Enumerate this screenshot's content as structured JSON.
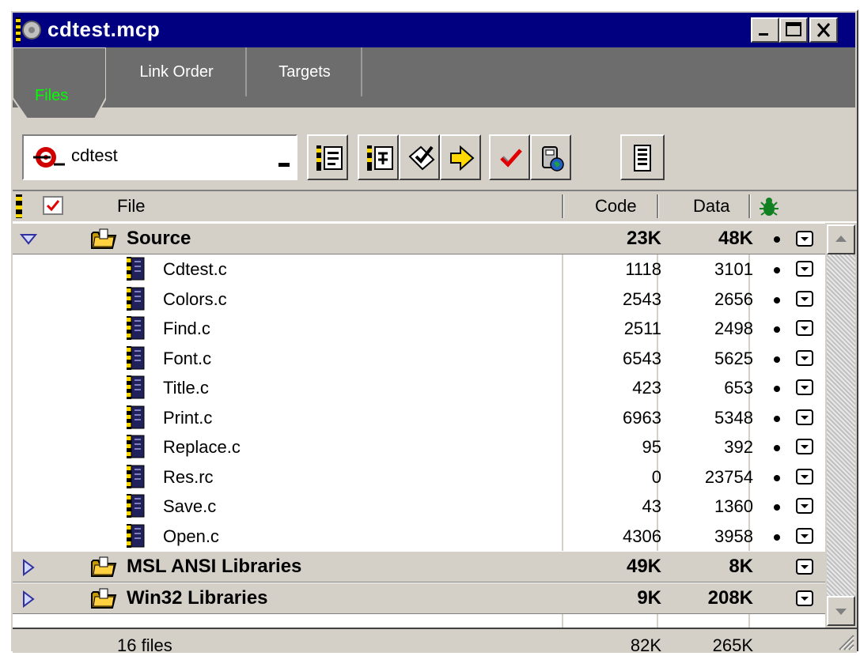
{
  "window": {
    "title": "cdtest.mcp",
    "controls": [
      "minimize-icon",
      "maximize-icon",
      "close-icon"
    ]
  },
  "tabs": [
    {
      "label": "Files",
      "active": true
    },
    {
      "label": "Link Order",
      "active": false
    },
    {
      "label": "Targets",
      "active": false
    }
  ],
  "toolbar": {
    "target_value": "cdtest",
    "buttons": [
      "settings-icon",
      "sync-icon",
      "check-icon",
      "compile-icon",
      "make-check-icon",
      "debug-icon",
      "project-info-icon"
    ]
  },
  "columns": {
    "file": "File",
    "code": "Code",
    "data": "Data"
  },
  "groups": [
    {
      "name": "Source",
      "code": "23K",
      "data": "48K",
      "expanded": true,
      "files": [
        {
          "name": "Cdtest.c",
          "code": "1118",
          "data": "3101"
        },
        {
          "name": "Colors.c",
          "code": "2543",
          "data": "2656"
        },
        {
          "name": "Find.c",
          "code": "2511",
          "data": "2498"
        },
        {
          "name": "Font.c",
          "code": "6543",
          "data": "5625"
        },
        {
          "name": "Title.c",
          "code": "423",
          "data": "653"
        },
        {
          "name": "Print.c",
          "code": "6963",
          "data": "5348"
        },
        {
          "name": "Replace.c",
          "code": "95",
          "data": "392"
        },
        {
          "name": "Res.rc",
          "code": "0",
          "data": "23754"
        },
        {
          "name": "Save.c",
          "code": "43",
          "data": "1360"
        },
        {
          "name": "Open.c",
          "code": "4306",
          "data": "3958"
        }
      ]
    },
    {
      "name": "MSL ANSI Libraries",
      "code": "49K",
      "data": "8K",
      "expanded": false,
      "files": []
    },
    {
      "name": "Win32 Libraries",
      "code": "9K",
      "data": "208K",
      "expanded": false,
      "files": []
    }
  ],
  "footer": {
    "count": "16 files",
    "code_total": "82K",
    "data_total": "265K"
  },
  "colors": {
    "titlebar": "#000080",
    "tabstrip": "#6d6d6d",
    "active_tab_text": "#00ff00",
    "face": "#d4d0c8"
  }
}
